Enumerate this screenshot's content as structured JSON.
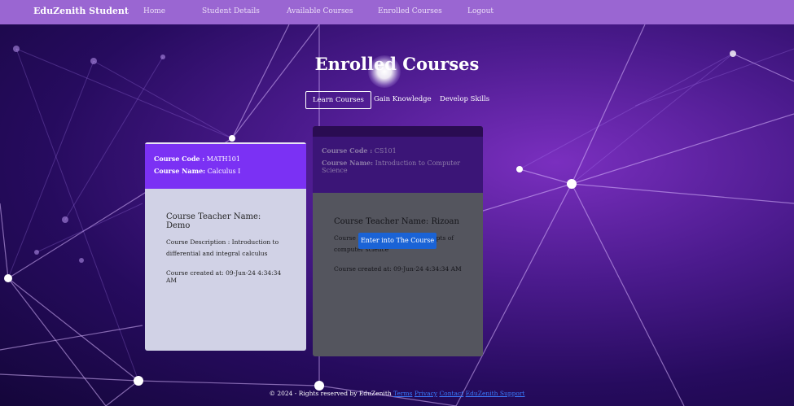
{
  "navbar": {
    "brand": "EduZenith Student",
    "links": [
      "Home",
      "Student Details",
      "Available Courses",
      "Enrolled Courses",
      "Logout"
    ]
  },
  "page_title": "Enrolled Courses",
  "tabs": [
    "Learn Courses",
    "Gain Knowledge",
    "Develop Skills"
  ],
  "courses": [
    {
      "code_label": "Course Code :",
      "code": "MATH101",
      "name_label": "Course Name:",
      "name": "Calculus I",
      "teacher": "Course Teacher Name: Demo",
      "description": "Course Description : Introduction to differential and integral calculus",
      "created": "Course created at: 09-Jun-24 4:34:34 AM"
    },
    {
      "code_label": "Course Code :",
      "code": "CS101",
      "name_label": "Course Name:",
      "name": "Introduction to Computer Science",
      "teacher": "Course Teacher Name: Rizoan",
      "description": "Course Description : Basic concepts of computer science",
      "created": "Course created at: 09-Jun-24 4:34:34 AM"
    }
  ],
  "enter_button": "Enter into The Course",
  "footer": {
    "text": "© 2024 - Rights reserved by EduZenith",
    "links": [
      "Terms",
      "Privacy",
      "Contact",
      "EduZenith Support"
    ]
  },
  "colors": {
    "navbar": "#9a66d2",
    "card1_header": "#7b31f4",
    "card2_header": "#3b1577",
    "button": "#1a63d6"
  }
}
